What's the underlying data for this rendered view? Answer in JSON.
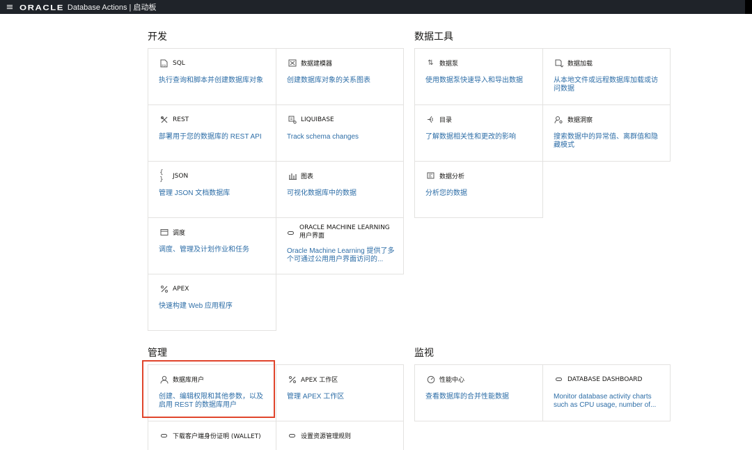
{
  "topbar": {
    "logo": "ORACLE",
    "app_title": "Database Actions | 启动板"
  },
  "sections": {
    "develop": "开发",
    "data_tools": "数据工具",
    "admin": "管理",
    "monitor": "监视"
  },
  "cards": {
    "sql": {
      "title": "SQL",
      "desc": "执行查询和脚本并创建数据库对象",
      "icon": "sql-icon"
    },
    "data_modeler": {
      "title": "数据建模器",
      "desc": "创建数据库对象的关系图表",
      "icon": "data-modeler-icon"
    },
    "rest": {
      "title": "REST",
      "desc": "部署用于您的数据库的 REST API",
      "icon": "rest-icon"
    },
    "liquibase": {
      "title": "LIQUIBASE",
      "desc": "Track schema changes",
      "icon": "liquibase-icon"
    },
    "json": {
      "title": "JSON",
      "desc": "管理 JSON 文档数据库",
      "icon": "braces-icon"
    },
    "charts": {
      "title": "图表",
      "desc": "可视化数据库中的数据",
      "icon": "bar-chart-icon"
    },
    "scheduling": {
      "title": "调度",
      "desc": "调度、管理及计划作业和任务",
      "icon": "calendar-icon"
    },
    "oml": {
      "title": "ORACLE MACHINE LEARNING 用户界面",
      "desc": "Oracle Machine Learning 提供了多个可通过公用用户界面访问的...",
      "icon": "pill-icon"
    },
    "apex": {
      "title": "APEX",
      "desc": "快速构建 Web 应用程序",
      "icon": "apex-icon"
    },
    "data_pump": {
      "title": "数据泵",
      "desc": "使用数据泵快速导入和导出数据",
      "icon": "up-down-arrows-icon"
    },
    "data_load": {
      "title": "数据加载",
      "desc": "从本地文件或远程数据库加载或访问数据",
      "icon": "data-load-icon"
    },
    "catalog": {
      "title": "目录",
      "desc": "了解数据相关性和更改的影响",
      "icon": "catalog-icon"
    },
    "data_insights": {
      "title": "数据洞察",
      "desc": "搜索数据中的异常值、离群值和隐藏模式",
      "icon": "user-search-icon"
    },
    "data_analysis": {
      "title": "数据分析",
      "desc": "分析您的数据",
      "icon": "analysis-icon"
    },
    "db_users": {
      "title": "数据库用户",
      "desc": "创建、编辑权限和其他参数，以及启用 REST 的数据库用户",
      "icon": "user-icon"
    },
    "apex_workspace": {
      "title": "APEX 工作区",
      "desc": "管理 APEX 工作区",
      "icon": "apex-icon"
    },
    "download_wallet": {
      "title": "下载客户端身份证明 (WALLET)",
      "icon": "pill-icon"
    },
    "resource_mgmt": {
      "title": "设置资源管理规则",
      "icon": "pill-icon"
    },
    "perf_hub": {
      "title": "性能中心",
      "desc": "查看数据库的合并性能数据",
      "icon": "gauge-icon"
    },
    "db_dashboard": {
      "title": "DATABASE DASHBOARD",
      "desc": "Monitor database activity charts such as CPU usage, number of...",
      "icon": "pill-icon"
    }
  }
}
